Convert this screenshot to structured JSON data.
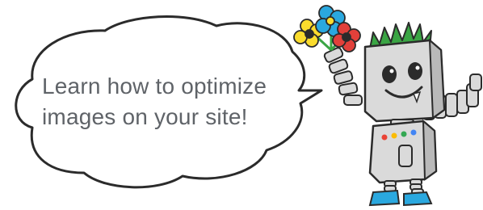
{
  "speech_bubble": {
    "line1": "Learn how to optimize",
    "line2": "images on your site!"
  },
  "colors": {
    "outline": "#2b2b2b",
    "text": "#5f6368",
    "robot_body": "#dadada",
    "robot_shadow": "#b9b9b9",
    "hair": "#3aa544",
    "shoes": "#2aa8df",
    "led_red": "#ea4335",
    "led_yellow": "#fbbc05",
    "led_green": "#34a853",
    "led_blue": "#4285f4",
    "flower_yellow": "#fbdc2d",
    "flower_blue": "#2aa8df",
    "flower_red": "#e2403a"
  },
  "icons": {
    "mascot": "robot-mascot-with-flowers",
    "bubble": "speech-bubble"
  }
}
